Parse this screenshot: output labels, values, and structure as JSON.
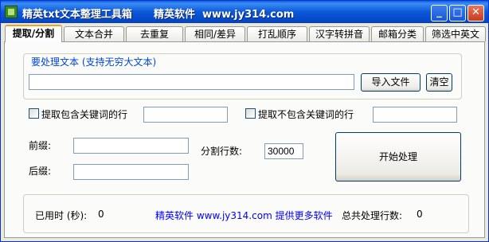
{
  "window": {
    "title": "精英txt文本整理工具箱      精英软件  www.jy314.com",
    "controls": {
      "minimize": "_",
      "maximize": "□",
      "close": "✕"
    }
  },
  "tabs": [
    {
      "label": "提取/分割",
      "active": true
    },
    {
      "label": "文本合并"
    },
    {
      "label": "去重复"
    },
    {
      "label": "相同/差异"
    },
    {
      "label": "打乱顺序"
    },
    {
      "label": "汉字转拼音"
    },
    {
      "label": "邮箱分类"
    },
    {
      "label": "筛选中英文"
    }
  ],
  "source": {
    "group_label": "要处理文本 (支持无穷大文本)",
    "path_value": "",
    "import_button": "导入文件",
    "clear_button": "清空"
  },
  "filters": {
    "include_label": "提取包含关键词的行",
    "include_checked": false,
    "include_value": "",
    "exclude_label": "提取不包含关键词的行",
    "exclude_checked": false,
    "exclude_value": ""
  },
  "split": {
    "prefix_label": "前缀:",
    "prefix_value": "",
    "suffix_label": "后缀:",
    "suffix_value": "",
    "lines_label": "分割行数:",
    "lines_value": "30000",
    "start_button": "开始处理"
  },
  "status": {
    "elapsed_label": "已用时 (秒):",
    "elapsed_value": "0",
    "promo_text": "精英软件  www.jy314.com 提供更多软件",
    "total_label": "总共处理行数:",
    "total_value": "0"
  }
}
